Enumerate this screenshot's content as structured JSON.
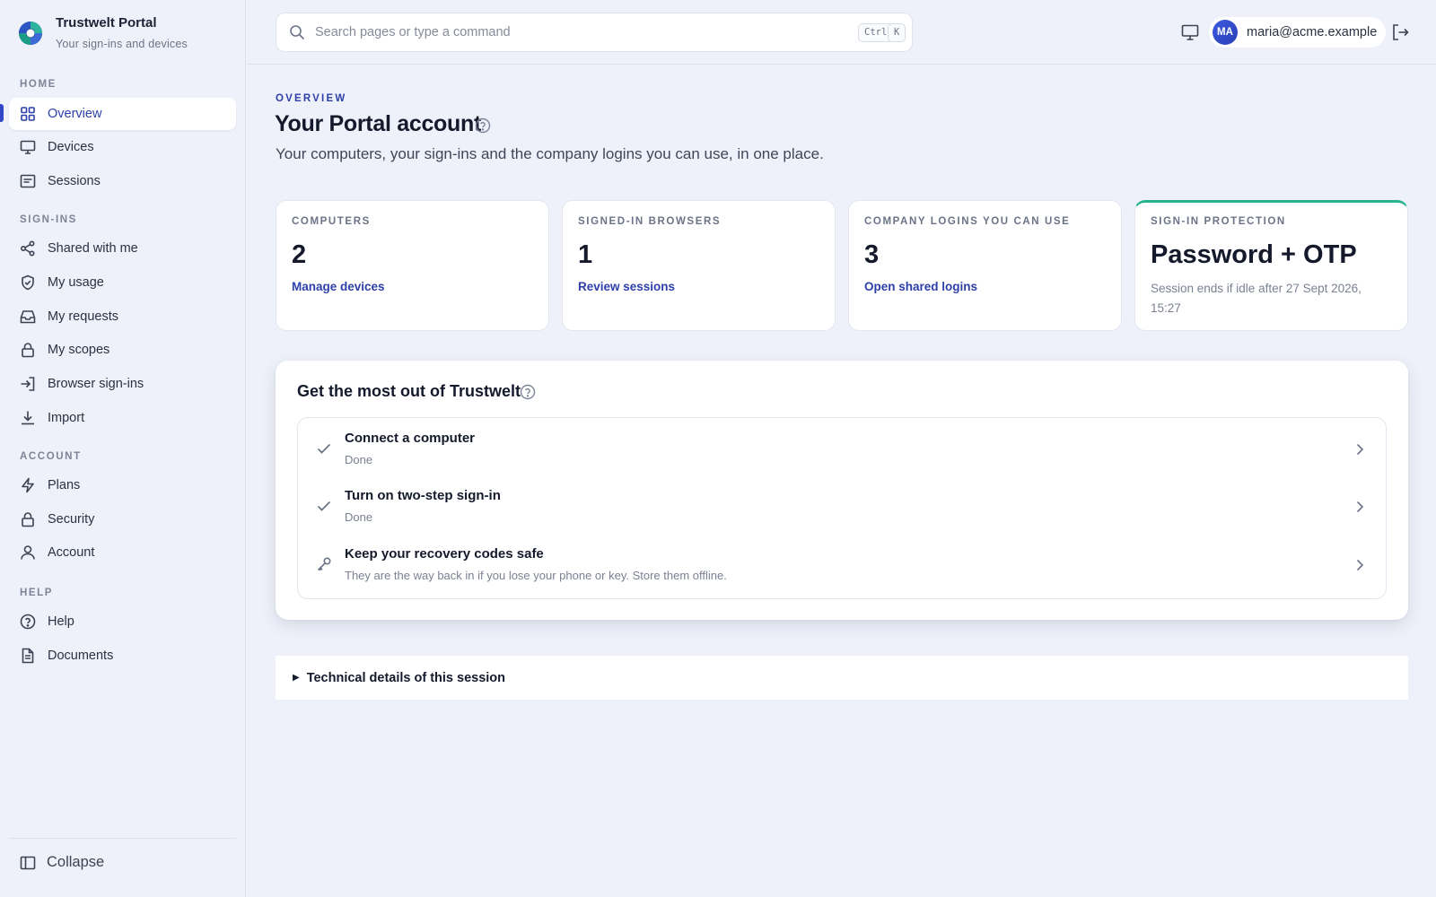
{
  "brand": {
    "title": "Trustwelt Portal",
    "subtitle": "Your sign-ins and devices",
    "logo_icon": "aperture-logo-icon"
  },
  "sidebar": {
    "sections": [
      {
        "label": "HOME",
        "items": [
          {
            "label": "Overview",
            "icon": "grid-icon",
            "active": true
          }
        ]
      },
      {
        "label": "",
        "items": [
          {
            "label": "Devices",
            "icon": "monitor-icon"
          },
          {
            "label": "Sessions",
            "icon": "browser-window-icon"
          }
        ]
      },
      {
        "label": "SIGN-INS",
        "items": [
          {
            "label": "Shared with me",
            "icon": "share-icon"
          },
          {
            "label": "My usage",
            "icon": "shield-icon"
          },
          {
            "label": "My requests",
            "icon": "inbox-icon"
          },
          {
            "label": "My scopes",
            "icon": "lock-icon"
          },
          {
            "label": "Browser sign-ins",
            "icon": "sign-in-icon"
          },
          {
            "label": "Import",
            "icon": "download-icon"
          }
        ]
      },
      {
        "label": "ACCOUNT",
        "items": [
          {
            "label": "Plans",
            "icon": "lightning-icon"
          },
          {
            "label": "Security",
            "icon": "lock-icon"
          },
          {
            "label": "Account",
            "icon": "user-icon"
          }
        ]
      },
      {
        "label": "HELP",
        "items": [
          {
            "label": "Help",
            "icon": "help-circle-icon"
          },
          {
            "label": "Documents",
            "icon": "document-icon"
          }
        ]
      }
    ],
    "collapse_label": "Collapse"
  },
  "topbar": {
    "search_placeholder": "Search pages or type a command",
    "search_value": "",
    "shortcut_keys": [
      "Ctrl",
      "K"
    ],
    "user_initials": "MA",
    "user_email": "maria@acme.example"
  },
  "main": {
    "eyebrow": "OVERVIEW",
    "title": "Your Portal account",
    "subtitle": "Your computers, your sign-ins and the company logins you can use, in one place.",
    "stats": [
      {
        "label": "COMPUTERS",
        "value": "2",
        "link": "Manage devices"
      },
      {
        "label": "SIGNED-IN BROWSERS",
        "value": "1",
        "link": "Review sessions"
      },
      {
        "label": "COMPANY LOGINS YOU CAN USE",
        "value": "3",
        "link": "Open shared logins"
      },
      {
        "label": "SIGN-IN PROTECTION",
        "value": "Password + OTP",
        "note": "Session ends if idle after 27 Sept 2026, 15:27"
      }
    ],
    "getting_started": {
      "title": "Get the most out of Trustwelt",
      "items": [
        {
          "title": "Connect a computer",
          "subtitle": "Done",
          "icon": "check-icon"
        },
        {
          "title": "Turn on two-step sign-in",
          "subtitle": "Done",
          "icon": "check-icon"
        },
        {
          "title": "Keep your recovery codes safe",
          "subtitle": "They are the way back in if you lose your phone or key. Store them offline.",
          "icon": "key-icon"
        }
      ]
    },
    "details_label": "Technical details of this session"
  },
  "colors": {
    "accent": "#2d3fa8",
    "success_bar": "#27b48c",
    "background": "#eef1f9"
  }
}
